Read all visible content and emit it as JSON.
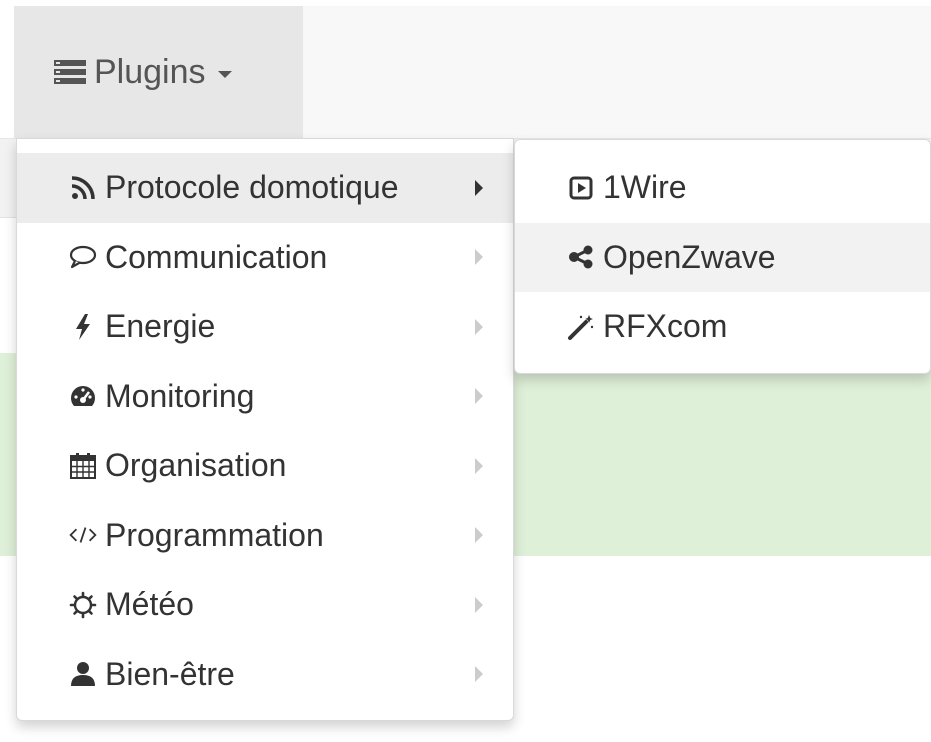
{
  "navbar": {
    "plugins_label": "Plugins",
    "plugins_icon": "server-icon"
  },
  "menu": {
    "items": [
      {
        "label": "Protocole domotique",
        "icon": "rss-icon",
        "active": true
      },
      {
        "label": "Communication",
        "icon": "comment-icon"
      },
      {
        "label": "Energie",
        "icon": "bolt-icon"
      },
      {
        "label": "Monitoring",
        "icon": "dashboard-icon"
      },
      {
        "label": "Organisation",
        "icon": "calendar-icon"
      },
      {
        "label": "Programmation",
        "icon": "code-icon"
      },
      {
        "label": "Météo",
        "icon": "sun-icon"
      },
      {
        "label": "Bien-être",
        "icon": "user-icon"
      }
    ]
  },
  "submenu": {
    "items": [
      {
        "label": "1Wire",
        "icon": "play-square-icon"
      },
      {
        "label": "OpenZwave",
        "icon": "share-icon",
        "hover": true
      },
      {
        "label": "RFXcom",
        "icon": "magic-wand-icon"
      }
    ]
  },
  "colors": {
    "navbar_bg": "#f8f8f8",
    "toggle_active_bg": "#e7e7e7",
    "menu_active_bg": "#ececec",
    "success_panel_bg": "#dff0d8",
    "text": "#333333"
  }
}
